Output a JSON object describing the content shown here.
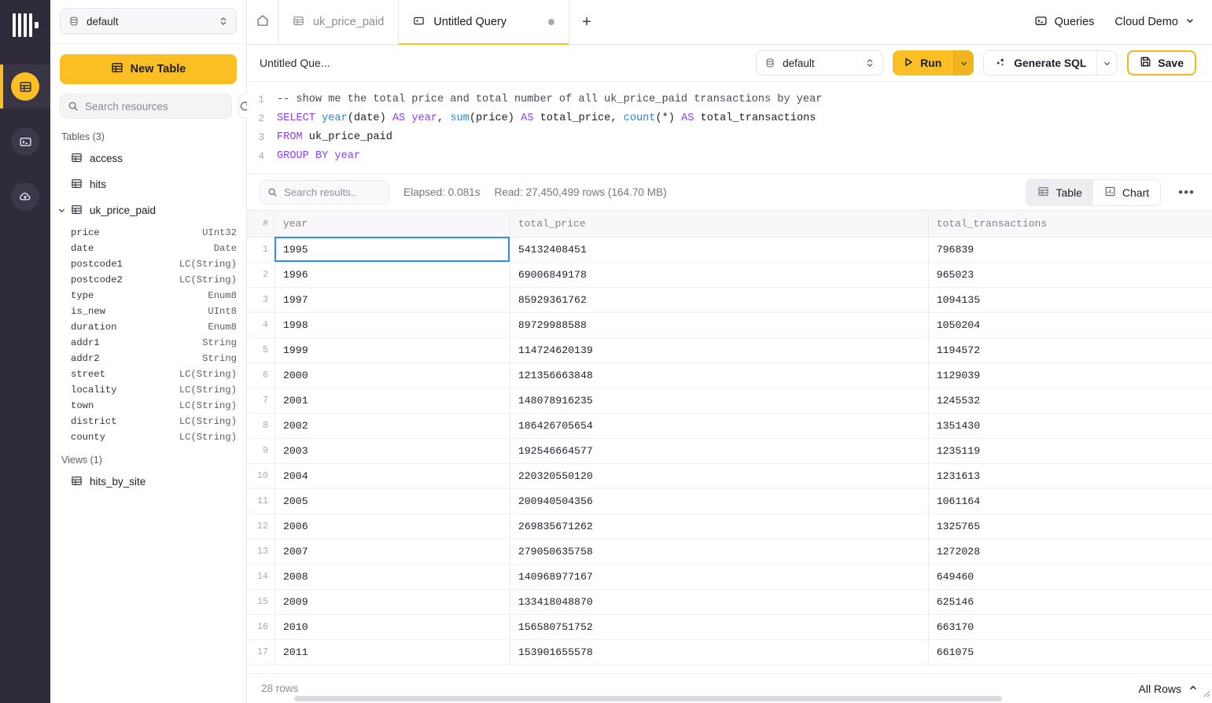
{
  "rail": {
    "logo_name": "clickhouse-logo",
    "items": [
      {
        "name": "tables-nav",
        "icon": "table-icon",
        "active": true
      },
      {
        "name": "sql-console-nav",
        "icon": "terminal-icon",
        "active": false
      },
      {
        "name": "data-sources-nav",
        "icon": "cloud-upload-icon",
        "active": false
      }
    ]
  },
  "sidebar": {
    "database_select": {
      "value": "default",
      "icon": "database-icon"
    },
    "new_table_label": "New Table",
    "search": {
      "placeholder": "Search resources",
      "value": ""
    },
    "refresh_label": "Refresh",
    "tables_group_label": "Tables (3)",
    "tables": [
      {
        "label": "access",
        "expanded": false
      },
      {
        "label": "hits",
        "expanded": false
      },
      {
        "label": "uk_price_paid",
        "expanded": true
      }
    ],
    "columns": [
      {
        "name": "price",
        "type": "UInt32"
      },
      {
        "name": "date",
        "type": "Date"
      },
      {
        "name": "postcode1",
        "type": "LC(String)"
      },
      {
        "name": "postcode2",
        "type": "LC(String)"
      },
      {
        "name": "type",
        "type": "Enum8"
      },
      {
        "name": "is_new",
        "type": "UInt8"
      },
      {
        "name": "duration",
        "type": "Enum8"
      },
      {
        "name": "addr1",
        "type": "String"
      },
      {
        "name": "addr2",
        "type": "String"
      },
      {
        "name": "street",
        "type": "LC(String)"
      },
      {
        "name": "locality",
        "type": "LC(String)"
      },
      {
        "name": "town",
        "type": "LC(String)"
      },
      {
        "name": "district",
        "type": "LC(String)"
      },
      {
        "name": "county",
        "type": "LC(String)"
      }
    ],
    "views_group_label": "Views (1)",
    "views": [
      {
        "label": "hits_by_site"
      }
    ]
  },
  "tabs": {
    "home_label": "Home",
    "items": [
      {
        "label": "uk_price_paid",
        "icon": "table-icon",
        "active": false,
        "dirty": false
      },
      {
        "label": "Untitled Query",
        "icon": "query-icon",
        "active": true,
        "dirty": true
      }
    ],
    "add_label": "+",
    "queries_label": "Queries",
    "account_label": "Cloud Demo"
  },
  "query_toolbar": {
    "title": "Untitled Que...",
    "database": "default",
    "run_label": "Run",
    "generate_sql_label": "Generate SQL",
    "save_label": "Save"
  },
  "editor": {
    "lines": [
      {
        "n": "1",
        "tokens": [
          {
            "t": "-- show me the total price and total number of all uk_price_paid transactions by year",
            "c": "cm"
          }
        ]
      },
      {
        "n": "2",
        "tokens": [
          {
            "t": "SELECT ",
            "c": "kw"
          },
          {
            "t": "year",
            "c": "fn"
          },
          {
            "t": "(",
            "c": "pn"
          },
          {
            "t": "date",
            "c": "code"
          },
          {
            "t": ")",
            "c": "pn"
          },
          {
            "t": " AS ",
            "c": "kw"
          },
          {
            "t": "year",
            "c": "kw"
          },
          {
            "t": ", ",
            "c": "pn"
          },
          {
            "t": "sum",
            "c": "fn"
          },
          {
            "t": "(",
            "c": "pn"
          },
          {
            "t": "price",
            "c": "code"
          },
          {
            "t": ")",
            "c": "pn"
          },
          {
            "t": " AS ",
            "c": "kw"
          },
          {
            "t": "total_price",
            "c": "code"
          },
          {
            "t": ", ",
            "c": "pn"
          },
          {
            "t": "count",
            "c": "fn"
          },
          {
            "t": "(*)",
            "c": "pn"
          },
          {
            "t": " AS ",
            "c": "kw"
          },
          {
            "t": "total_transactions",
            "c": "code"
          }
        ]
      },
      {
        "n": "3",
        "tokens": [
          {
            "t": "FROM ",
            "c": "kw"
          },
          {
            "t": "uk_price_paid",
            "c": "code"
          }
        ]
      },
      {
        "n": "4",
        "tokens": [
          {
            "t": "GROUP BY ",
            "c": "kw"
          },
          {
            "t": "year",
            "c": "kw"
          }
        ]
      }
    ]
  },
  "results_toolbar": {
    "search_placeholder": "Search results..",
    "search_value": "",
    "elapsed": "Elapsed: 0.081s",
    "read": "Read: 27,450,499 rows (164.70 MB)",
    "view_modes": [
      {
        "label": "Table",
        "icon": "table-icon",
        "active": true
      },
      {
        "label": "Chart",
        "icon": "chart-icon",
        "active": false
      }
    ],
    "more_label": "•••"
  },
  "results_table": {
    "index_header": "#",
    "columns": [
      "year",
      "total_price",
      "total_transactions"
    ],
    "selected_cell": {
      "row": 1,
      "column": "year"
    },
    "rows": [
      {
        "i": "1",
        "year": "1995",
        "total_price": "54132408451",
        "total_transactions": "796839"
      },
      {
        "i": "2",
        "year": "1996",
        "total_price": "69006849178",
        "total_transactions": "965023"
      },
      {
        "i": "3",
        "year": "1997",
        "total_price": "85929361762",
        "total_transactions": "1094135"
      },
      {
        "i": "4",
        "year": "1998",
        "total_price": "89729988588",
        "total_transactions": "1050204"
      },
      {
        "i": "5",
        "year": "1999",
        "total_price": "114724620139",
        "total_transactions": "1194572"
      },
      {
        "i": "6",
        "year": "2000",
        "total_price": "121356663848",
        "total_transactions": "1129039"
      },
      {
        "i": "7",
        "year": "2001",
        "total_price": "148078916235",
        "total_transactions": "1245532"
      },
      {
        "i": "8",
        "year": "2002",
        "total_price": "186426705654",
        "total_transactions": "1351430"
      },
      {
        "i": "9",
        "year": "2003",
        "total_price": "192546664577",
        "total_transactions": "1235119"
      },
      {
        "i": "10",
        "year": "2004",
        "total_price": "220320550120",
        "total_transactions": "1231613"
      },
      {
        "i": "11",
        "year": "2005",
        "total_price": "200940504356",
        "total_transactions": "1061164"
      },
      {
        "i": "12",
        "year": "2006",
        "total_price": "269835671262",
        "total_transactions": "1325765"
      },
      {
        "i": "13",
        "year": "2007",
        "total_price": "279050635758",
        "total_transactions": "1272028"
      },
      {
        "i": "14",
        "year": "2008",
        "total_price": "140968977167",
        "total_transactions": "649460"
      },
      {
        "i": "15",
        "year": "2009",
        "total_price": "133418048870",
        "total_transactions": "625146"
      },
      {
        "i": "16",
        "year": "2010",
        "total_price": "156580751752",
        "total_transactions": "663170"
      },
      {
        "i": "17",
        "year": "2011",
        "total_price": "153901655578",
        "total_transactions": "661075"
      }
    ]
  },
  "statusbar": {
    "rows_label": "28 rows",
    "all_rows_label": "All Rows"
  },
  "colors": {
    "accent": "#fbbf24",
    "rail_bg": "#2f2b3a",
    "selection_blue": "#2d8cf0"
  }
}
